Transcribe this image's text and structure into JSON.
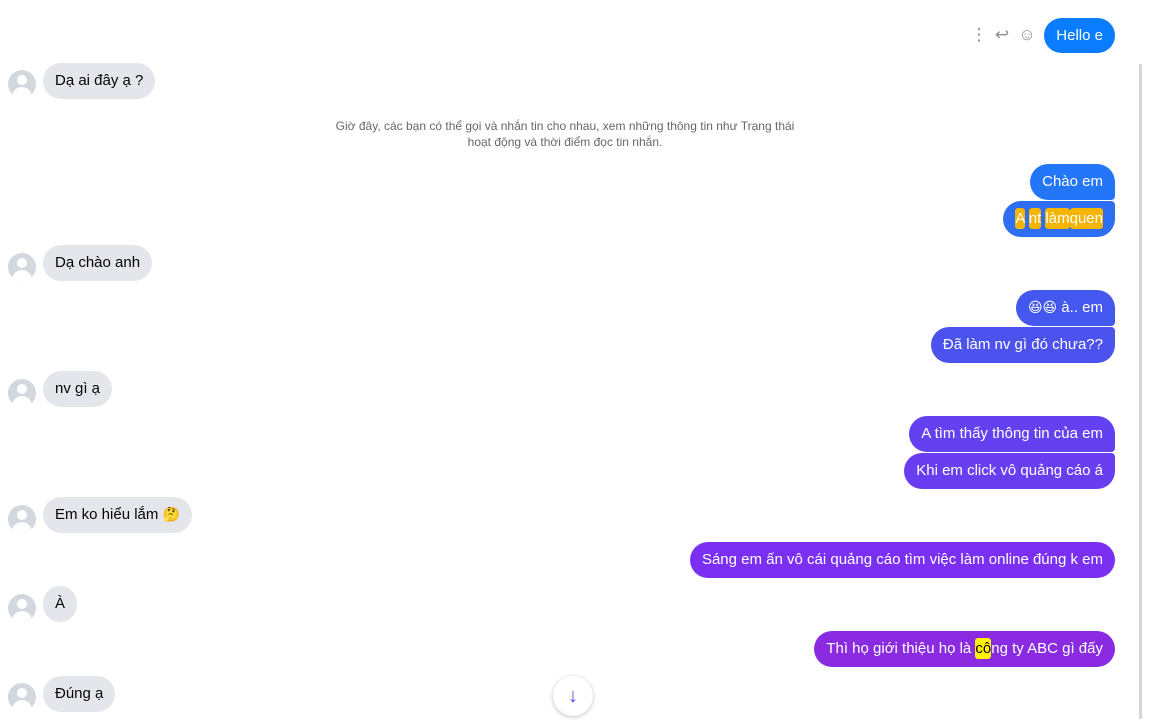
{
  "colors": {
    "incoming_bubble": "#e4e6eb",
    "outgoing_gradient": [
      "#0a7cff",
      "#2f6bf0",
      "#4c55ee",
      "#6a3df0",
      "#7b2ff2",
      "#8a2be2"
    ],
    "scroll_arrow": "#4f46e5"
  },
  "message_actions": {
    "more_icon": "⋮",
    "reply_icon": "↩",
    "react_icon": "☺"
  },
  "notice": "Giờ đây, các bạn có thể gọi và nhắn tin cho nhau, xem những thông tin như Trạng thái hoạt động và thời điểm đọc tin nhắn.",
  "messages": {
    "out_hello": "Hello e",
    "in_da_ai_day": "Dạ ai đây ạ ?",
    "out_chao_em": "Chào em",
    "out_a_nt_lam_quen": {
      "w1": "A",
      "w2": "nt",
      "w3": "làm",
      "w4": "quen"
    },
    "in_da_chao_anh": "Dạ chào anh",
    "out_a_em": {
      "emoji": "😆😆",
      "text": " à.. em"
    },
    "out_da_lam_nv": "Đã làm nv gì đó chưa??",
    "in_nv_gi_a": "nv gì ạ",
    "out_a_tim_thay": "A tìm thấy thông tin của em",
    "out_khi_em_click": "Khi em click vô quảng cáo á",
    "in_em_ko_hieu": {
      "text": "Em ko hiểu lắm ",
      "emoji": "🤔"
    },
    "out_sang_em": "Sáng em ấn vô cái quảng cáo tìm việc làm online đúng k em",
    "in_a": "À",
    "out_thi_ho": {
      "before": "Thì họ giới thiệu họ là ",
      "highlight": "cô",
      "after": "ng ty ABC gì đấy"
    },
    "in_dung_a": "Đúng ạ"
  },
  "scroll_down_icon": "↓"
}
